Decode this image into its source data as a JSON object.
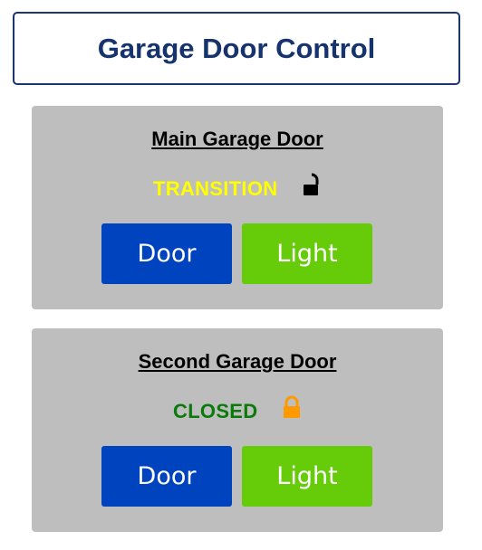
{
  "header": {
    "title": "Garage Door Control"
  },
  "colors": {
    "header_text": "#17336e",
    "card_bg": "#bebebe",
    "door_button": "#0043be",
    "light_button": "#66cc0a",
    "status_transition": "#ffff00",
    "status_closed": "#0a7a0a",
    "lock_open": "#000000",
    "lock_closed": "#ff9900"
  },
  "doors": [
    {
      "title": "Main Garage Door",
      "status": "TRANSITION",
      "lock_icon": "lock-open-icon",
      "door_button": "Door",
      "light_button": "Light"
    },
    {
      "title": "Second Garage Door",
      "status": "CLOSED",
      "lock_icon": "lock-closed-icon",
      "door_button": "Door",
      "light_button": "Light"
    }
  ]
}
